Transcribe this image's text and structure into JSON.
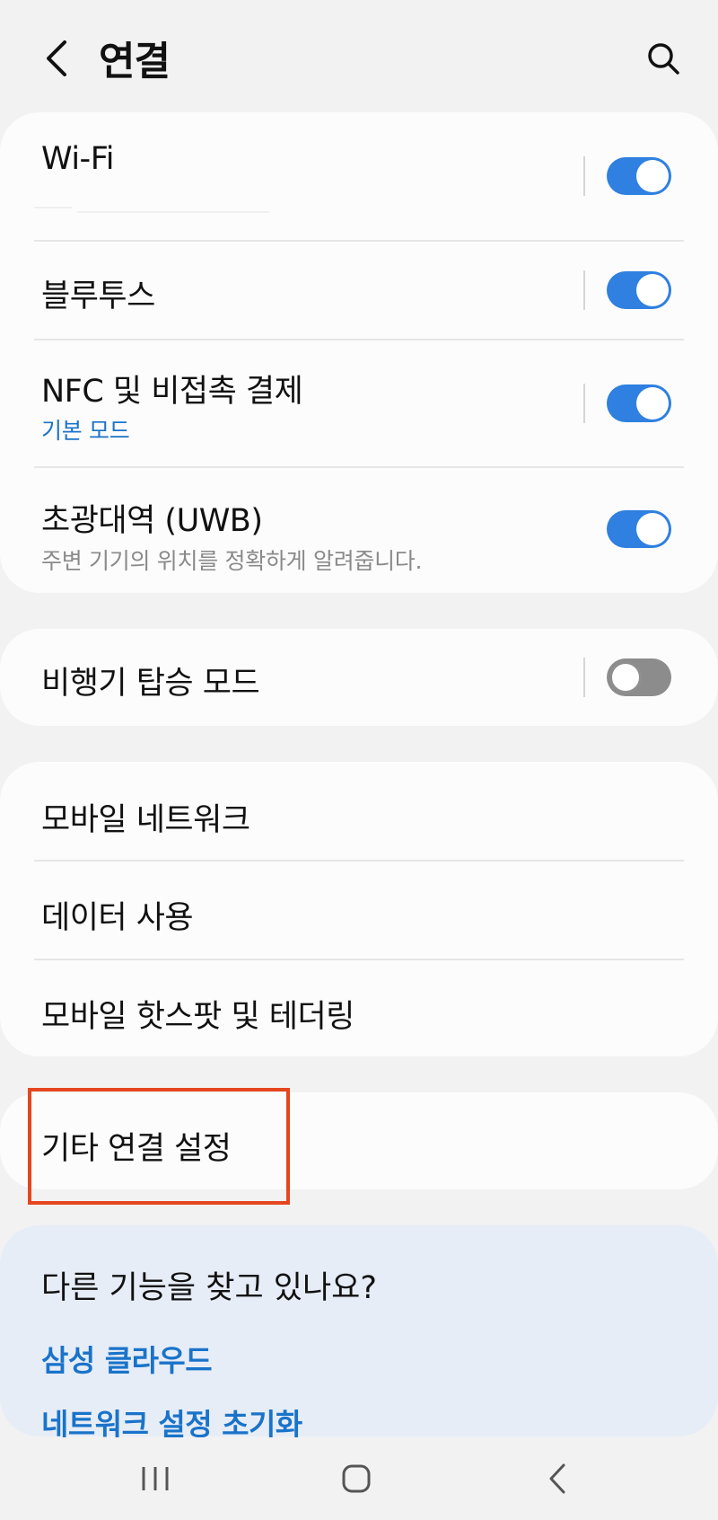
{
  "header": {
    "title": "연결",
    "back_icon": "back-arrow-icon",
    "search_icon": "search-icon"
  },
  "connections": {
    "wifi": {
      "label": "Wi-Fi",
      "enabled": true
    },
    "bluetooth": {
      "label": "블루투스",
      "enabled": true
    },
    "nfc": {
      "label": "NFC 및 비접촉 결제",
      "sub": "기본 모드",
      "enabled": true
    },
    "uwb": {
      "label": "초광대역 (UWB)",
      "sub": "주변 기기의 위치를 정확하게 알려줍니다.",
      "enabled": true
    }
  },
  "airplane": {
    "label": "비행기 탑승 모드",
    "enabled": false
  },
  "mobile": {
    "items": [
      {
        "label": "모바일 네트워크"
      },
      {
        "label": "데이터 사용"
      },
      {
        "label": "모바일 핫스팟 및 테더링"
      }
    ]
  },
  "other": {
    "label": "기타 연결 설정"
  },
  "suggestions": {
    "title": "다른 기능을 찾고 있나요?",
    "links": [
      "삼성 클라우드",
      "네트워크 설정 초기화"
    ]
  },
  "colors": {
    "accent": "#2f80e0",
    "link": "#1a73c9",
    "highlight": "#e5461f",
    "background": "#f2f2f2",
    "suggest_bg": "#e6edf7"
  },
  "navbar": {
    "recents_icon": "recents-icon",
    "home_icon": "home-icon",
    "back_icon": "back-nav-icon"
  }
}
